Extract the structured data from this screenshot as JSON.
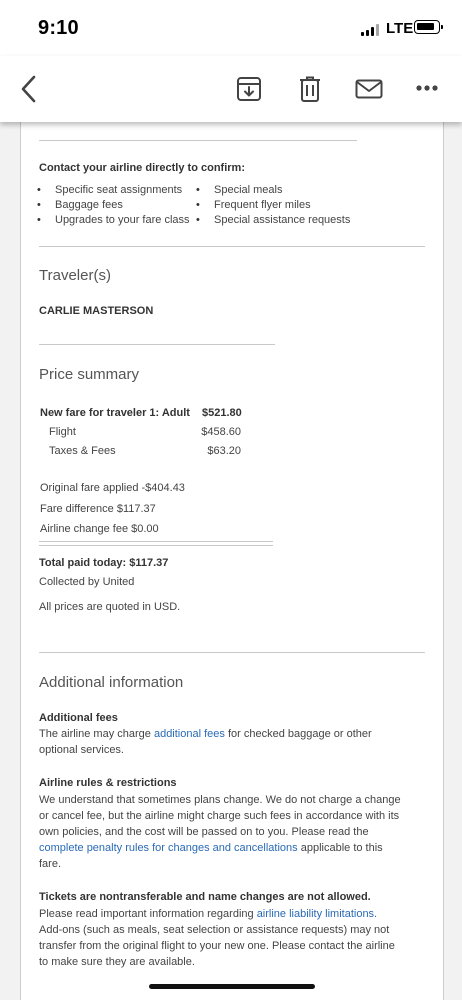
{
  "status_bar": {
    "time": "9:10",
    "network": "LTE"
  },
  "toolbar": {
    "icons": [
      "back-chevron",
      "archive",
      "trash",
      "mail",
      "more"
    ]
  },
  "confirm": {
    "heading": "Contact your airline directly to confirm:",
    "left_items": [
      "Specific seat assignments",
      "Baggage fees",
      "Upgrades to your fare class"
    ],
    "right_items": [
      "Special meals",
      "Frequent flyer miles",
      "Special assistance requests"
    ]
  },
  "travelers": {
    "heading": "Traveler(s)",
    "name": "CARLIE MASTERSON"
  },
  "price_summary": {
    "heading": "Price summary",
    "new_fare_label": "New fare for traveler 1: Adult",
    "new_fare_value": "$521.80",
    "flight_label": "Flight",
    "flight_value": "$458.60",
    "taxes_label": "Taxes & Fees",
    "taxes_value": "$63.20",
    "original_fare": "Original fare applied -$404.43",
    "fare_difference": "Fare difference $117.37",
    "change_fee": "Airline change fee $0.00",
    "total_label": "Total paid today:",
    "total_value": "$117.37",
    "collected_by": "Collected by United",
    "currency_note": "All prices are quoted in USD."
  },
  "additional": {
    "heading": "Additional information",
    "fees_heading": "Additional fees",
    "fees_text_1": "The airline may charge",
    "fees_link": "additional fees",
    "fees_text_2": "for checked baggage or other",
    "fees_text_3": "optional services.",
    "rules_heading": "Airline rules & restrictions",
    "rules_line_1": "We understand that sometimes plans change. We do not charge a change",
    "rules_line_2": "or cancel fee, but the airline might charge such fees in accordance with its",
    "rules_line_3": "own policies, and the cost will be passed on to you. Please read the",
    "rules_link": "complete penalty rules for changes and cancellations",
    "rules_line_4_tail": "applicable to this",
    "rules_line_5": "fare.",
    "tickets_heading": "Tickets are nontransferable and name changes are not allowed.",
    "tickets_line_1": "Please read important information regarding",
    "tickets_link": "airline liability limitations.",
    "tickets_line_2": "Add-ons (such as meals, seat selection or assistance requests) may not",
    "tickets_line_3": "transfer from the original flight to your new one. Please contact the airline",
    "tickets_line_4": "to make sure they are available."
  }
}
